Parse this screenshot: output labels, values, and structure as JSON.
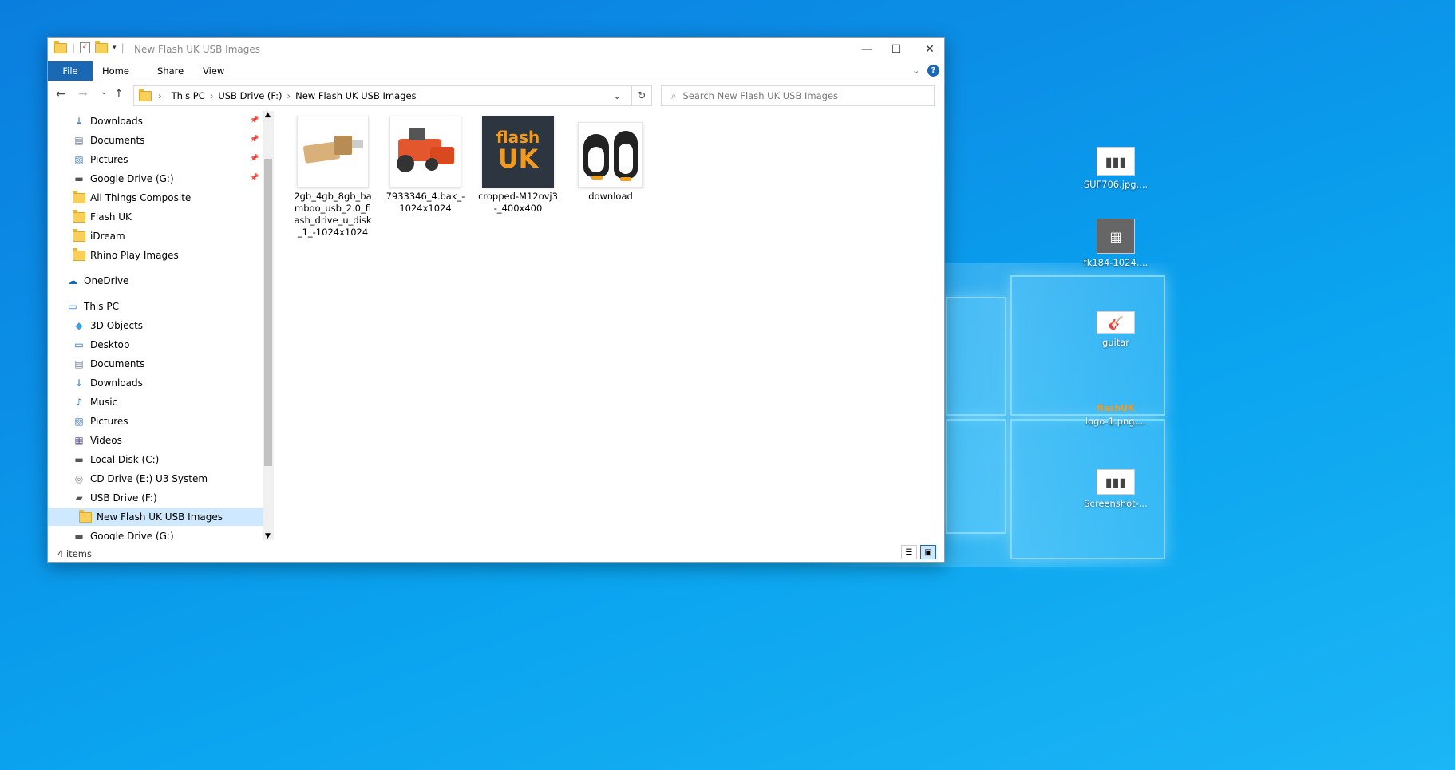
{
  "window": {
    "title": "New Flash UK USB Images",
    "ribbon_tabs": [
      "File",
      "Home",
      "Share",
      "View"
    ],
    "breadcrumb": [
      "This PC",
      "USB Drive (F:)",
      "New Flash UK USB Images"
    ],
    "search_placeholder": "Search New Flash UK USB Images",
    "status": "4 items"
  },
  "nav": {
    "quick_access": [
      {
        "label": "Downloads",
        "icon": "download-icon"
      },
      {
        "label": "Documents",
        "icon": "document-icon"
      },
      {
        "label": "Pictures",
        "icon": "pictures-icon"
      },
      {
        "label": "Google Drive (G:)",
        "icon": "drive-icon"
      },
      {
        "label": "All Things Composite",
        "icon": "folder-icon"
      },
      {
        "label": "Flash UK",
        "icon": "folder-icon"
      },
      {
        "label": "iDream",
        "icon": "folder-icon"
      },
      {
        "label": "Rhino Play Images",
        "icon": "folder-icon"
      }
    ],
    "onedrive": "OneDrive",
    "thispc": "This PC",
    "thispc_items": [
      {
        "label": "3D Objects",
        "icon": "3d-objects-icon"
      },
      {
        "label": "Desktop",
        "icon": "desktop-icon"
      },
      {
        "label": "Documents",
        "icon": "document-icon"
      },
      {
        "label": "Downloads",
        "icon": "download-icon"
      },
      {
        "label": "Music",
        "icon": "music-icon"
      },
      {
        "label": "Pictures",
        "icon": "pictures-icon"
      },
      {
        "label": "Videos",
        "icon": "videos-icon"
      },
      {
        "label": "Local Disk (C:)",
        "icon": "drive-icon"
      },
      {
        "label": "CD Drive (E:) U3 System",
        "icon": "cd-icon"
      },
      {
        "label": "USB Drive (F:)",
        "icon": "usb-icon"
      },
      {
        "label": "New Flash UK USB Images",
        "icon": "folder-icon"
      },
      {
        "label": "Google Drive (G:)",
        "icon": "drive-icon"
      }
    ]
  },
  "files": [
    {
      "label": "2gb_4gb_8gb_bamboo_usb_2.0_flash_drive_u_disk_1_-1024x1024"
    },
    {
      "label": "7933346_4.bak_-1024x1024"
    },
    {
      "label": "cropped-M12ovj3-_400x400",
      "logo_text_1": "flash",
      "logo_text_2": "UK"
    },
    {
      "label": "download"
    }
  ],
  "desktop_icons": [
    {
      "label": "SUF706.jpg...."
    },
    {
      "label": "fk184-1024...."
    },
    {
      "label": "guitar"
    },
    {
      "label": "logo-1.png....",
      "logo_a": "flash",
      "logo_b": "UK"
    },
    {
      "label": "Screenshot-..."
    }
  ],
  "colors": {
    "accent": "#1a68b3",
    "selection": "#cde8ff",
    "logo_orange": "#f39a1e"
  }
}
